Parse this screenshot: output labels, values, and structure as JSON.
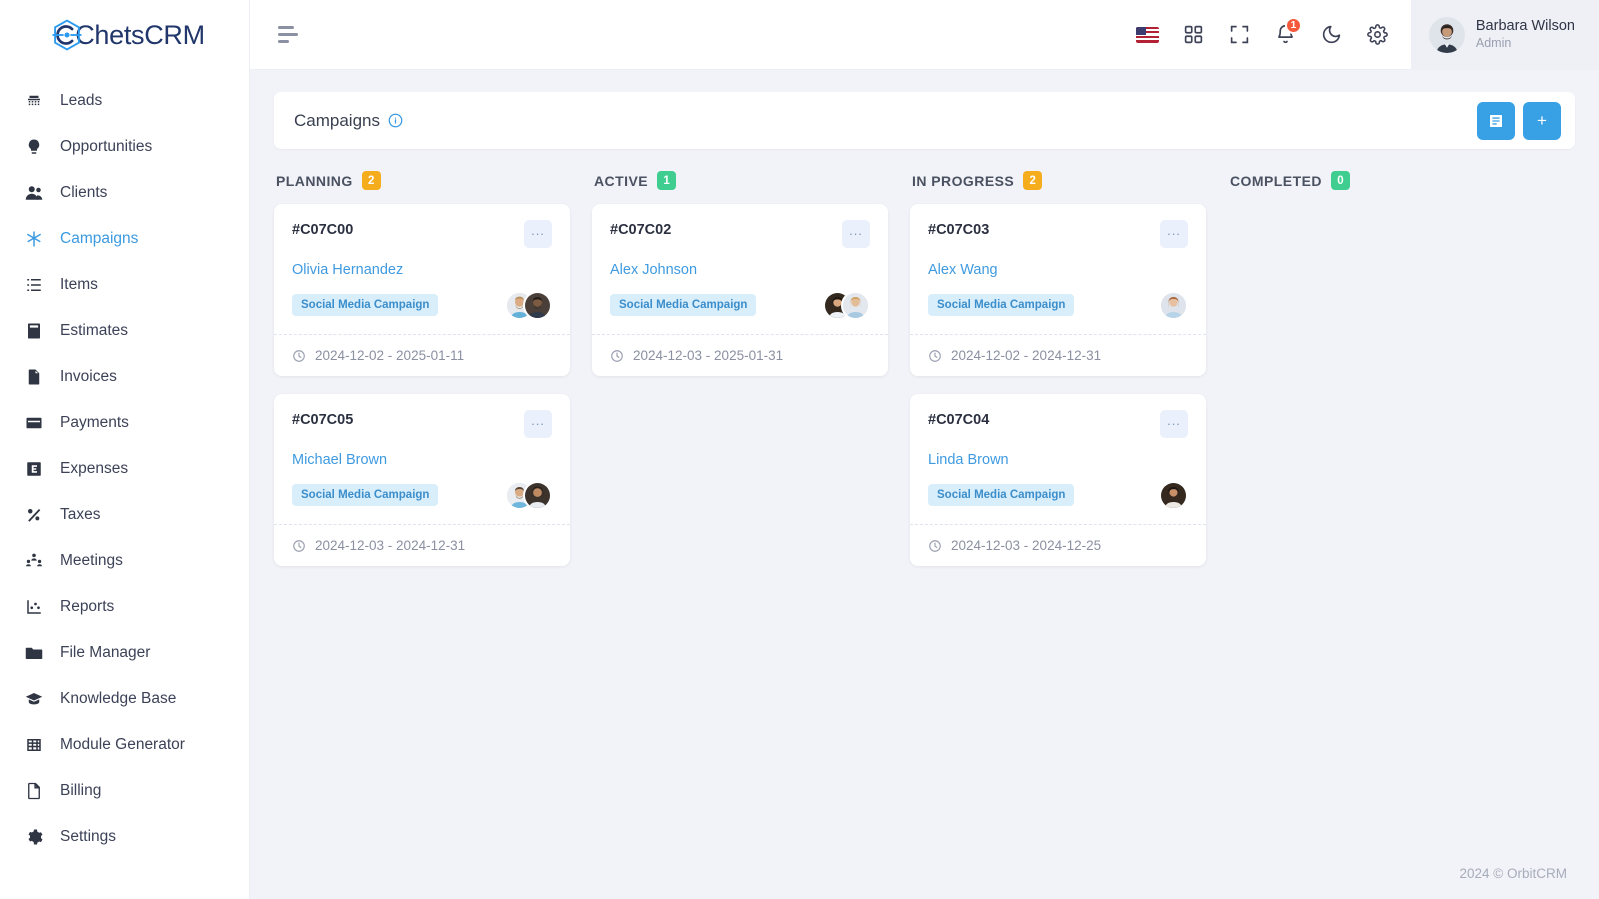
{
  "brand": {
    "name_prefix": "C",
    "name": "hetsCRM",
    "full": "ChetsCRM"
  },
  "sidebar": {
    "items": [
      {
        "label": "Leads",
        "icon": "phone-icon",
        "active": false
      },
      {
        "label": "Opportunities",
        "icon": "lightbulb-icon",
        "active": false
      },
      {
        "label": "Clients",
        "icon": "users-icon",
        "active": false
      },
      {
        "label": "Campaigns",
        "icon": "asterisk-icon",
        "active": true
      },
      {
        "label": "Items",
        "icon": "list-icon",
        "active": false
      },
      {
        "label": "Estimates",
        "icon": "calculator-icon",
        "active": false
      },
      {
        "label": "Invoices",
        "icon": "file-icon",
        "active": false
      },
      {
        "label": "Payments",
        "icon": "credit-card-icon",
        "active": false
      },
      {
        "label": "Expenses",
        "icon": "expense-box-icon",
        "active": false
      },
      {
        "label": "Taxes",
        "icon": "percent-icon",
        "active": false
      },
      {
        "label": "Meetings",
        "icon": "people-group-icon",
        "active": false
      },
      {
        "label": "Reports",
        "icon": "chart-scatter-icon",
        "active": false
      },
      {
        "label": "File Manager",
        "icon": "folder-icon",
        "active": false
      },
      {
        "label": "Knowledge Base",
        "icon": "graduation-cap-icon",
        "active": false
      },
      {
        "label": "Module Generator",
        "icon": "grid-table-icon",
        "active": false
      },
      {
        "label": "Billing",
        "icon": "document-icon",
        "active": false
      },
      {
        "label": "Settings",
        "icon": "gear-icon",
        "active": false
      }
    ]
  },
  "topbar": {
    "menu_toggle": "hamburger-icon",
    "icons": [
      {
        "name": "language-flag-us",
        "label": "US"
      },
      {
        "name": "apps-grid-icon",
        "label": "Apps"
      },
      {
        "name": "fullscreen-icon",
        "label": "Fullscreen"
      },
      {
        "name": "notifications-bell-icon",
        "label": "Notifications",
        "badge": "1"
      },
      {
        "name": "dark-mode-moon-icon",
        "label": "Dark mode"
      },
      {
        "name": "settings-gear-icon",
        "label": "Settings"
      }
    ],
    "notification_count": "1",
    "user": {
      "name": "Barbara Wilson",
      "role": "Admin"
    }
  },
  "page": {
    "title": "Campaigns",
    "info_icon": "info-circle-icon",
    "actions": [
      {
        "name": "list-view-button",
        "icon": "list-view-icon"
      },
      {
        "name": "add-campaign-button",
        "icon": "plus-icon",
        "label": "+"
      }
    ]
  },
  "colors": {
    "accent": "#38a0e4",
    "badge_yellow": "#f5ad1d",
    "badge_green": "#3fce8f",
    "tag_bg": "#d9eefb",
    "tag_text": "#3b8ecb",
    "link": "#3f9ae0",
    "notification": "#f4593c"
  },
  "board": {
    "columns": [
      {
        "title": "PLANNING",
        "count": "2",
        "count_color": "#f5ad1d",
        "cards": [
          {
            "code": "#C07C00",
            "person": "Olivia Hernandez",
            "tag": "Social Media Campaign",
            "dates": "2024-12-02 - 2025-01-11",
            "menu": "...",
            "avatars": 2,
            "avatar_colors": [
              "#cfd6de",
              "#6c5b4e"
            ]
          },
          {
            "code": "#C07C05",
            "person": "Michael Brown",
            "tag": "Social Media Campaign",
            "dates": "2024-12-03 - 2024-12-31",
            "menu": "...",
            "avatars": 2,
            "avatar_colors": [
              "#d8dde4",
              "#4a3a33"
            ]
          }
        ]
      },
      {
        "title": "ACTIVE",
        "count": "1",
        "count_color": "#3fce8f",
        "cards": [
          {
            "code": "#C07C02",
            "person": "Alex Johnson",
            "tag": "Social Media Campaign",
            "dates": "2024-12-03 - 2025-01-31",
            "menu": "...",
            "avatars": 2,
            "avatar_colors": [
              "#3b3330",
              "#e3c9a8"
            ]
          }
        ]
      },
      {
        "title": "IN PROGRESS",
        "count": "2",
        "count_color": "#f5ad1d",
        "cards": [
          {
            "code": "#C07C03",
            "person": "Alex Wang",
            "tag": "Social Media Campaign",
            "dates": "2024-12-02 - 2024-12-31",
            "menu": "...",
            "avatars": 1,
            "avatar_colors": [
              "#c9a58a"
            ]
          },
          {
            "code": "#C07C04",
            "person": "Linda Brown",
            "tag": "Social Media Campaign",
            "dates": "2024-12-03 - 2024-12-25",
            "menu": "...",
            "avatars": 1,
            "avatar_colors": [
              "#3a2a22"
            ]
          }
        ]
      },
      {
        "title": "COMPLETED",
        "count": "0",
        "count_color": "#3fce8f",
        "cards": []
      }
    ]
  },
  "footer": {
    "copyright": "2024 © OrbitCRM"
  }
}
